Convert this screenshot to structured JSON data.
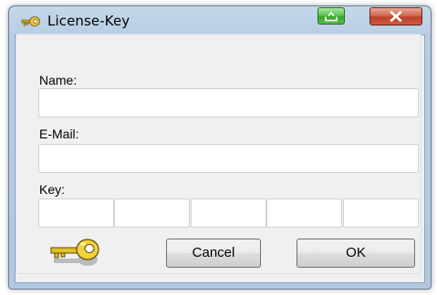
{
  "window": {
    "title": "License-Key"
  },
  "form": {
    "name_label": "Name:",
    "name_value": "",
    "email_label": "E-Mail:",
    "email_value": "",
    "key_label": "Key:",
    "key_segments": [
      "",
      "",
      "",
      "",
      ""
    ]
  },
  "buttons": {
    "cancel": "Cancel",
    "ok": "OK"
  },
  "icons": {
    "title_icon": "key-icon",
    "footer_icon": "key-icon",
    "title_green_button": "upload-icon",
    "close_button": "close-icon"
  }
}
